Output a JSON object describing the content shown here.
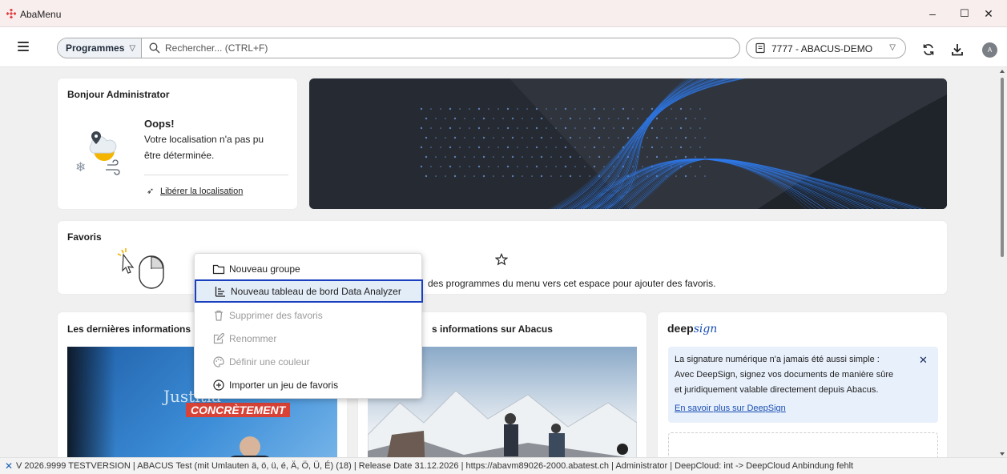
{
  "window": {
    "title": "AbaMenu",
    "controls": {
      "minimize": "–",
      "maximize": "☐",
      "close": "✕"
    }
  },
  "toolbar": {
    "programs_label": "Programmes",
    "search_placeholder": "Rechercher... (CTRL+F)",
    "mandant": "7777 - ABACUS-DEMO",
    "avatar_initial": "A"
  },
  "greeting": {
    "title": "Bonjour Administrator",
    "weather_heading": "Oops!",
    "weather_msg_line1": "Votre localisation n'a pas pu",
    "weather_msg_line2": "être déterminée.",
    "location_link": "Libérer la localisation"
  },
  "favorites": {
    "title": "Favoris",
    "hint": "des programmes du menu vers cet espace pour ajouter des favoris."
  },
  "news_left": {
    "title": "Les dernières informations"
  },
  "news_mid": {
    "title": "s informations sur Abacus"
  },
  "news_image_text": {
    "line1": "Justitia",
    "line2": "CONCRÈTEMENT"
  },
  "deepsign": {
    "logo_prefix": "deep",
    "logo_suffix": "sign",
    "line1": "La signature numérique n'a jamais été aussi simple :",
    "line2": "Avec DeepSign, signez vos documents de manière sûre",
    "line3": "et juridiquement valable directement depuis Abacus.",
    "link": "En savoir plus sur DeepSign"
  },
  "context_menu": {
    "items": [
      {
        "label": "Nouveau groupe",
        "icon": "folder-icon",
        "enabled": true
      },
      {
        "label": "Nouveau tableau de bord Data Analyzer",
        "icon": "dashboard-icon",
        "enabled": true,
        "selected": true
      },
      {
        "label": "Supprimer des favoris",
        "icon": "trash-icon",
        "enabled": false
      },
      {
        "label": "Renommer",
        "icon": "edit-icon",
        "enabled": false
      },
      {
        "label": "Définir une couleur",
        "icon": "palette-icon",
        "enabled": false
      },
      {
        "label": "Importer un jeu de favoris",
        "icon": "plus-circle-icon",
        "enabled": true
      }
    ]
  },
  "statusbar": {
    "text": "V 2026.9999 TESTVERSION | ABACUS Test (mit Umlauten ä, ö, ü, é, Ä, Ö, Ü, É) (18) | Release Date 31.12.2026 | https://abavm89026-2000.abatest.ch | Administrator | DeepCloud: int -> DeepCloud Anbindung fehlt"
  },
  "colors": {
    "accent": "#1a3fbf",
    "hero_bg": "#262b33",
    "hero_wave": "#2f7cf0",
    "link_blue": "#1a4fb4",
    "deepsign_box": "#e8f0fb"
  }
}
